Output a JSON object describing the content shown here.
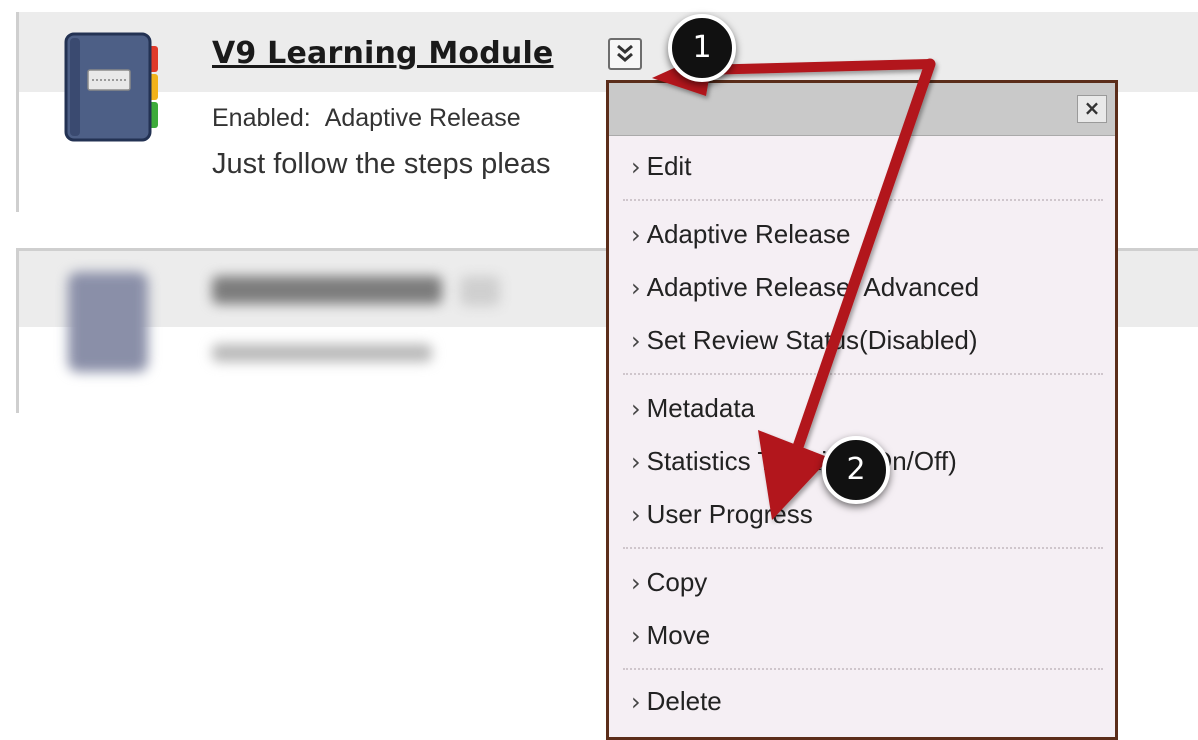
{
  "item": {
    "title": "V9 Learning Module",
    "enabled_label": "Enabled:",
    "enabled_value": "Adaptive Release",
    "description": "Just follow the steps pleas"
  },
  "menu": {
    "close_label": "×",
    "items": [
      {
        "label": "Edit"
      },
      {
        "label": "Adaptive Release"
      },
      {
        "label": "Adaptive Release: Advanced"
      },
      {
        "label": "Set Review Status(Disabled)"
      },
      {
        "label": "Metadata"
      },
      {
        "label": "Statistics Tracking (On/Off)"
      },
      {
        "label": "User Progress"
      },
      {
        "label": "Copy"
      },
      {
        "label": "Move"
      },
      {
        "label": "Delete"
      }
    ]
  },
  "callouts": {
    "step1": "1",
    "step2": "2"
  },
  "icons": {
    "module_icon": "notebook-icon",
    "menu_toggle": "chevron-double-down-icon",
    "close": "close-icon",
    "caret": "chevron-right-icon"
  },
  "colors": {
    "arrow": "#b2161b",
    "menu_border": "#5b2d1a",
    "menu_bg": "#f5eff4",
    "header_bg": "#c9c9c9"
  }
}
